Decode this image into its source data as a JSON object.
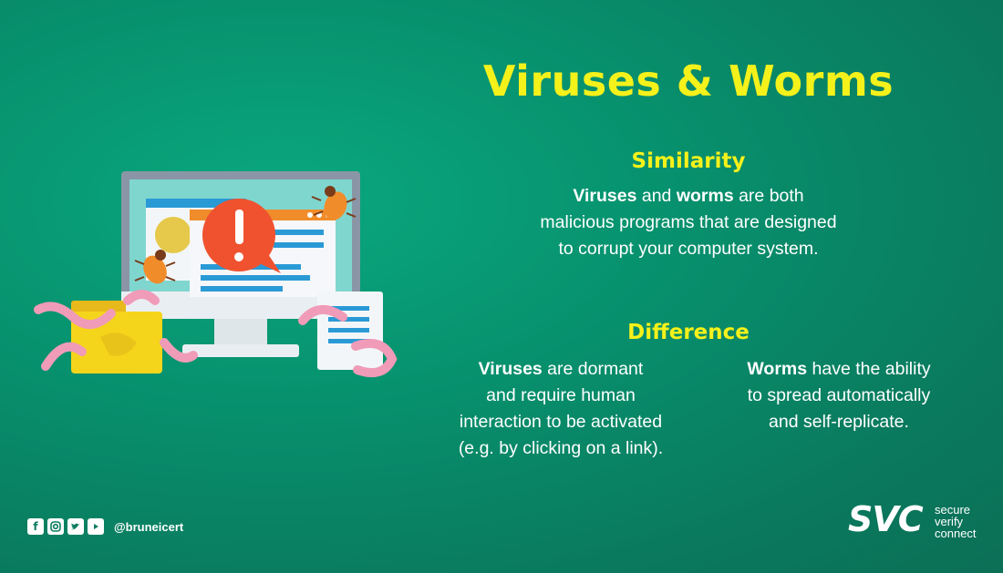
{
  "title": "Viruses & Worms",
  "similarity": {
    "heading": "Similarity",
    "b1": "Viruses",
    "t1": " and ",
    "b2": "worms",
    "t2": " are both",
    "line2": "malicious programs that are designed",
    "line3": "to corrupt your computer system."
  },
  "difference": {
    "heading": "Difference",
    "viruses": {
      "bold": "Viruses",
      "rest1": " are dormant",
      "line2": "and require human",
      "line3": "interaction to be activated",
      "line4": "(e.g. by clicking on a link)."
    },
    "worms": {
      "bold": "Worms",
      "rest1": " have the ability",
      "line2": "to spread automatically",
      "line3": "and self-replicate."
    }
  },
  "footer": {
    "social_icons": [
      "facebook-icon",
      "instagram-icon",
      "twitter-icon",
      "youtube-icon"
    ],
    "handle": "@bruneicert",
    "brand_mark": "SVC",
    "brand_words": [
      "secure",
      "verify",
      "connect"
    ]
  },
  "colors": {
    "background": "#07936f",
    "heading": "#f5f11a",
    "text": "#ffffff",
    "alert": "#f0522f",
    "worm": "#f09bb8",
    "folder": "#f5d51c"
  }
}
